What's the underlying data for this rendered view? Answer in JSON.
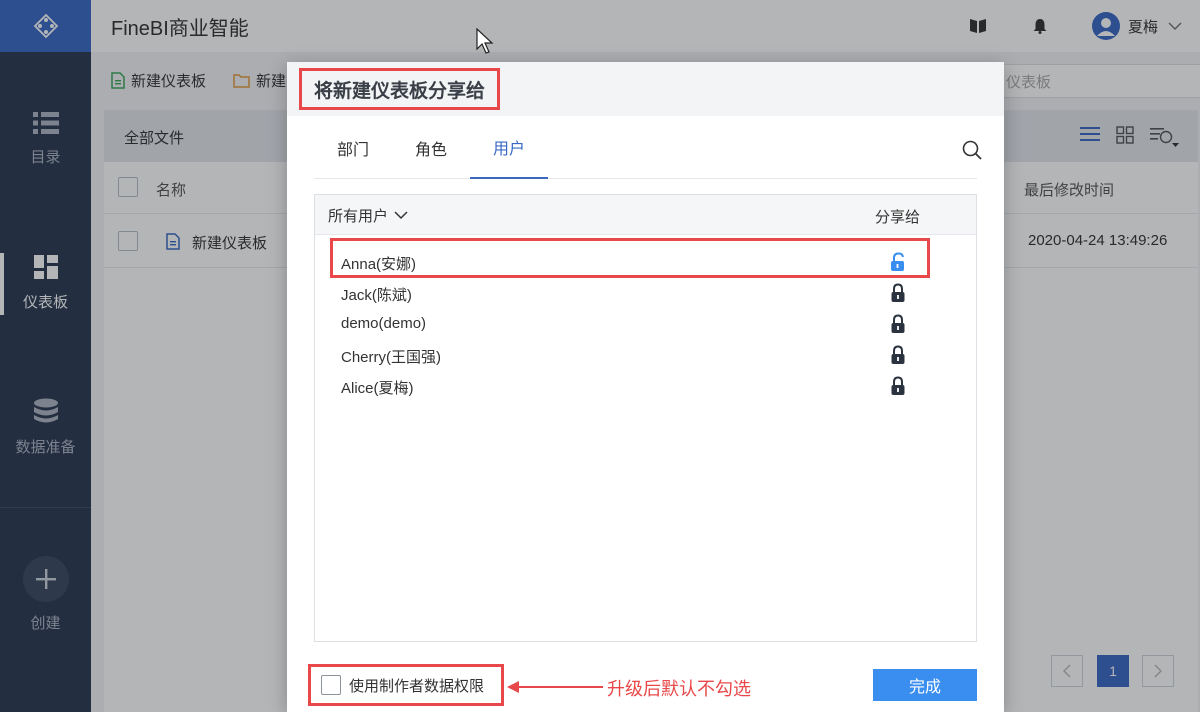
{
  "app": {
    "title": "FineBI商业智能"
  },
  "colors": {
    "sidebar": "#2b3950",
    "accent": "#3a68c4",
    "highlight": "#e8484a",
    "primary_button": "#3a8ef0"
  },
  "sidebar": {
    "items": [
      {
        "label": "目录",
        "icon": "list-icon"
      },
      {
        "label": "仪表板",
        "icon": "dashboard-icon",
        "active": true
      },
      {
        "label": "数据准备",
        "icon": "database-icon"
      },
      {
        "label": "创建",
        "icon": "plus-icon"
      }
    ]
  },
  "topbar": {
    "user_name": "夏梅"
  },
  "toolbar": {
    "new_dashboard_label": "新建仪表板",
    "new_folder_label": "新建",
    "search_placeholder": "仪表板"
  },
  "file_panel": {
    "breadcrumb": "全部文件",
    "columns": {
      "name": "名称",
      "modified": "最后修改时间"
    },
    "rows": [
      {
        "name": "新建仪表板",
        "modified": "2020-04-24 13:49:26"
      }
    ],
    "pagination": {
      "current_page": "1"
    }
  },
  "modal": {
    "title": "将新建仪表板分享给",
    "tabs": [
      {
        "label": "部门"
      },
      {
        "label": "角色"
      },
      {
        "label": "用户",
        "active": true
      }
    ],
    "list": {
      "filter_label": "所有用户",
      "share_column": "分享给",
      "users": [
        {
          "name": "Anna(安娜)",
          "shared": true
        },
        {
          "name": "Jack(陈斌)",
          "shared": false
        },
        {
          "name": "demo(demo)",
          "shared": false
        },
        {
          "name": "Cherry(王国强)",
          "shared": false
        },
        {
          "name": "Alice(夏梅)",
          "shared": false
        }
      ]
    },
    "use_creator_permission_label": "使用制作者数据权限",
    "annotation": "升级后默认不勾选",
    "done_label": "完成"
  }
}
